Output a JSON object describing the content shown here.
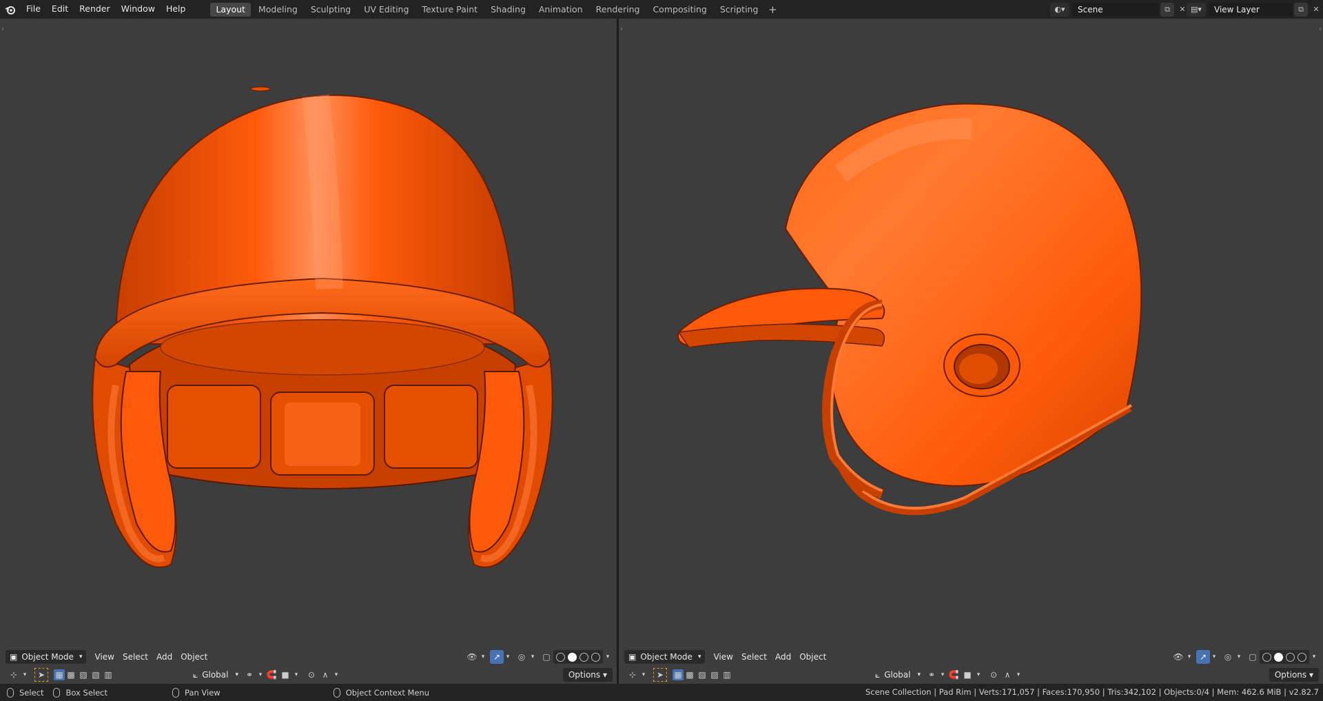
{
  "topbar": {
    "menus": [
      "File",
      "Edit",
      "Render",
      "Window",
      "Help"
    ],
    "workspaces": [
      "Layout",
      "Modeling",
      "Sculpting",
      "UV Editing",
      "Texture Paint",
      "Shading",
      "Animation",
      "Rendering",
      "Compositing",
      "Scripting"
    ],
    "active_workspace": "Layout",
    "scene_name": "Scene",
    "view_layer_name": "View Layer"
  },
  "viewport_left": {
    "mode": "Object Mode",
    "menus": [
      "View",
      "Select",
      "Add",
      "Object"
    ],
    "transform_orientation": "Global",
    "options_label": "Options"
  },
  "viewport_right": {
    "mode": "Object Mode",
    "menus": [
      "View",
      "Select",
      "Add",
      "Object"
    ],
    "transform_orientation": "Global",
    "options_label": "Options"
  },
  "statusbar": {
    "select_label": "Select",
    "box_select_label": "Box Select",
    "pan_view_label": "Pan View",
    "context_menu_label": "Object Context Menu",
    "stats": "Scene Collection | Pad Rim | Verts:171,057 | Faces:170,950 | Tris:342,102 | Objects:0/4 | Mem: 462.6 MiB | v2.82.7"
  },
  "colors": {
    "helmet_orange": "#ff5a0a",
    "viewport_bg": "#3d3d3d",
    "accent_blue": "#4772b3"
  }
}
